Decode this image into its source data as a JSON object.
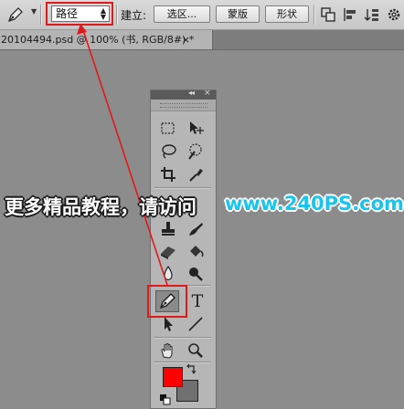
{
  "options_bar": {
    "mode_value": "路径",
    "build_label": "建立:",
    "selection_button": "选区...",
    "mask_button": "蒙版",
    "shape_button": "形状"
  },
  "document": {
    "tab_title": "20104494.psd @ 100% (书, RGB/8#) *",
    "close_glyph": "×"
  },
  "tools_panel": {
    "collapse_glyph": "◂◂",
    "close_glyph": "×",
    "type_tool_glyph": "T",
    "foreground_color": "#ff0000",
    "background_color": "#707070",
    "selected_tool": "pen-tool"
  },
  "watermark": {
    "text_cn": "更多精品教程，请访问",
    "url": "www.240PS.com"
  },
  "annotation": {
    "highlight_color": "#e0191b"
  }
}
